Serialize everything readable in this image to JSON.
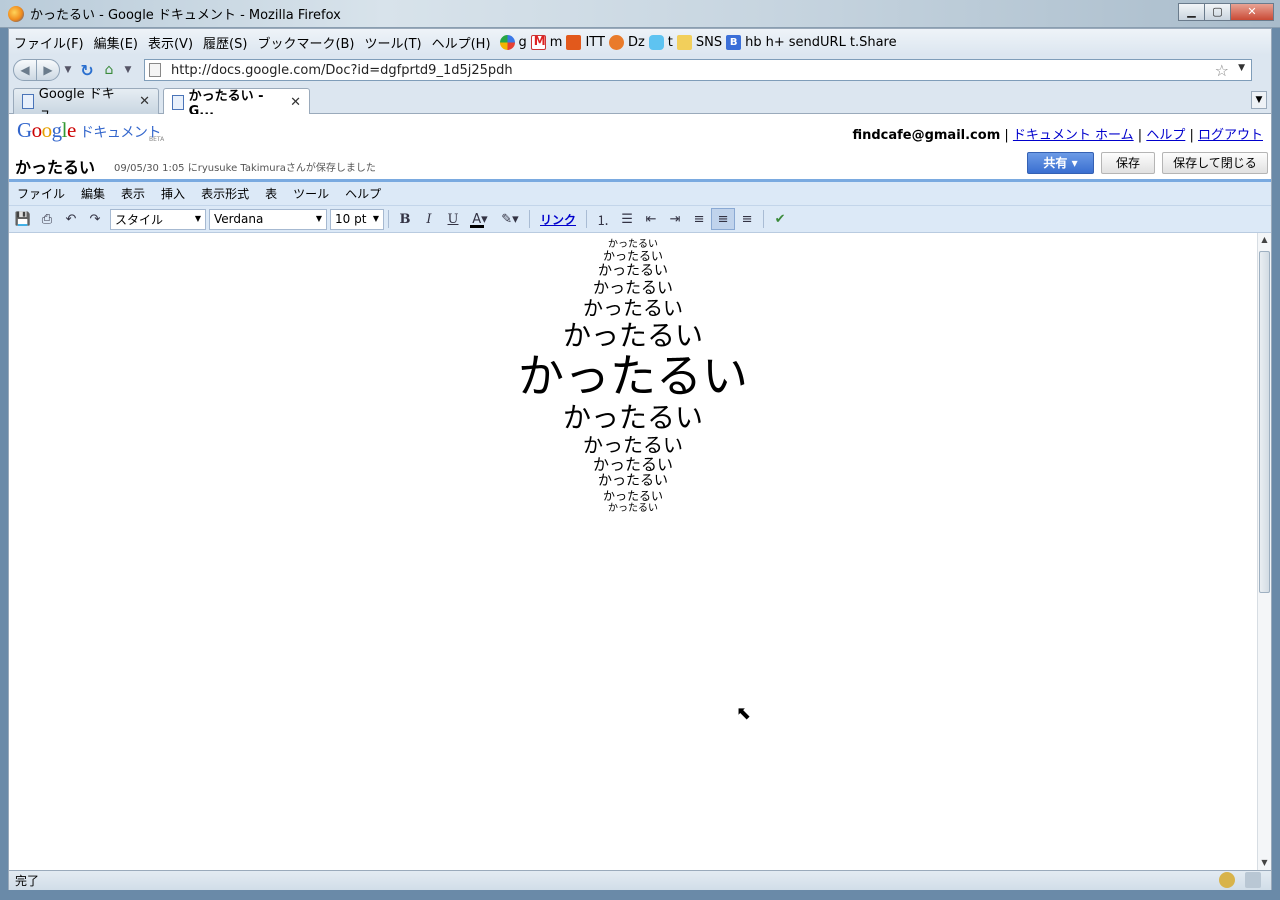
{
  "window": {
    "title": "かったるい - Google ドキュメント - Mozilla Firefox"
  },
  "menubar": {
    "items": [
      "ファイル(F)",
      "編集(E)",
      "表示(V)",
      "履歴(S)",
      "ブックマーク(B)",
      "ツール(T)",
      "ヘルプ(H)"
    ],
    "bookmarks": [
      {
        "label": "g",
        "icon": "google-icon"
      },
      {
        "label": "m",
        "icon": "gmail-icon"
      },
      {
        "label": "ITT",
        "icon": "itt-icon"
      },
      {
        "label": "Dz",
        "icon": "dzone-icon"
      },
      {
        "label": "t",
        "icon": "twitter-icon"
      },
      {
        "label": "SNS",
        "icon": "folder-icon"
      },
      {
        "label": "hb",
        "icon": "hatena-bookmark-icon"
      },
      {
        "label": "h+",
        "icon": "page-icon"
      },
      {
        "label": "sendURL",
        "icon": "page-icon"
      },
      {
        "label": "t.Share",
        "icon": "page-icon"
      }
    ]
  },
  "navbar": {
    "url": "http://docs.google.com/Doc?id=dgfprtd9_1d5j25pdh"
  },
  "tabs": [
    {
      "label": "Google ドキュ...",
      "active": false
    },
    {
      "label": "かったるい - G...",
      "active": true
    }
  ],
  "doc": {
    "logo_text": "Google",
    "logo_sub": "ドキュメント",
    "beta": "BETA",
    "user_email": "findcafe@gmail.com",
    "link_home": "ドキュメント ホーム",
    "link_help": "ヘルプ",
    "link_logout": "ログアウト",
    "title": "かったるい",
    "saved_status": "09/05/30 1:05 にryusuke Takimuraさんが保存しました",
    "share_label": "共有 ▾",
    "save_label": "保存",
    "save_close_label": "保存して閉じる"
  },
  "docmenu": [
    "ファイル",
    "編集",
    "表示",
    "挿入",
    "表示形式",
    "表",
    "ツール",
    "ヘルプ"
  ],
  "toolbar": {
    "style_value": "スタイル",
    "font_value": "Verdana",
    "size_value": "10 pt",
    "link_label": "リンク"
  },
  "content": {
    "lines": [
      {
        "text": "かったるい",
        "size": 10
      },
      {
        "text": "かったるい",
        "size": 12
      },
      {
        "text": "かったるい",
        "size": 14
      },
      {
        "text": "かったるい",
        "size": 16
      },
      {
        "text": "かったるい",
        "size": 20
      },
      {
        "text": "かったるい",
        "size": 28
      },
      {
        "text": "かったるい",
        "size": 46
      },
      {
        "text": "かったるい",
        "size": 28
      },
      {
        "text": "かったるい",
        "size": 20
      },
      {
        "text": "かったるい",
        "size": 16
      },
      {
        "text": "かったるい",
        "size": 14
      },
      {
        "text": "かったるい",
        "size": 12
      },
      {
        "text": "かったるい",
        "size": 10
      }
    ]
  },
  "status": {
    "text": "完了"
  }
}
